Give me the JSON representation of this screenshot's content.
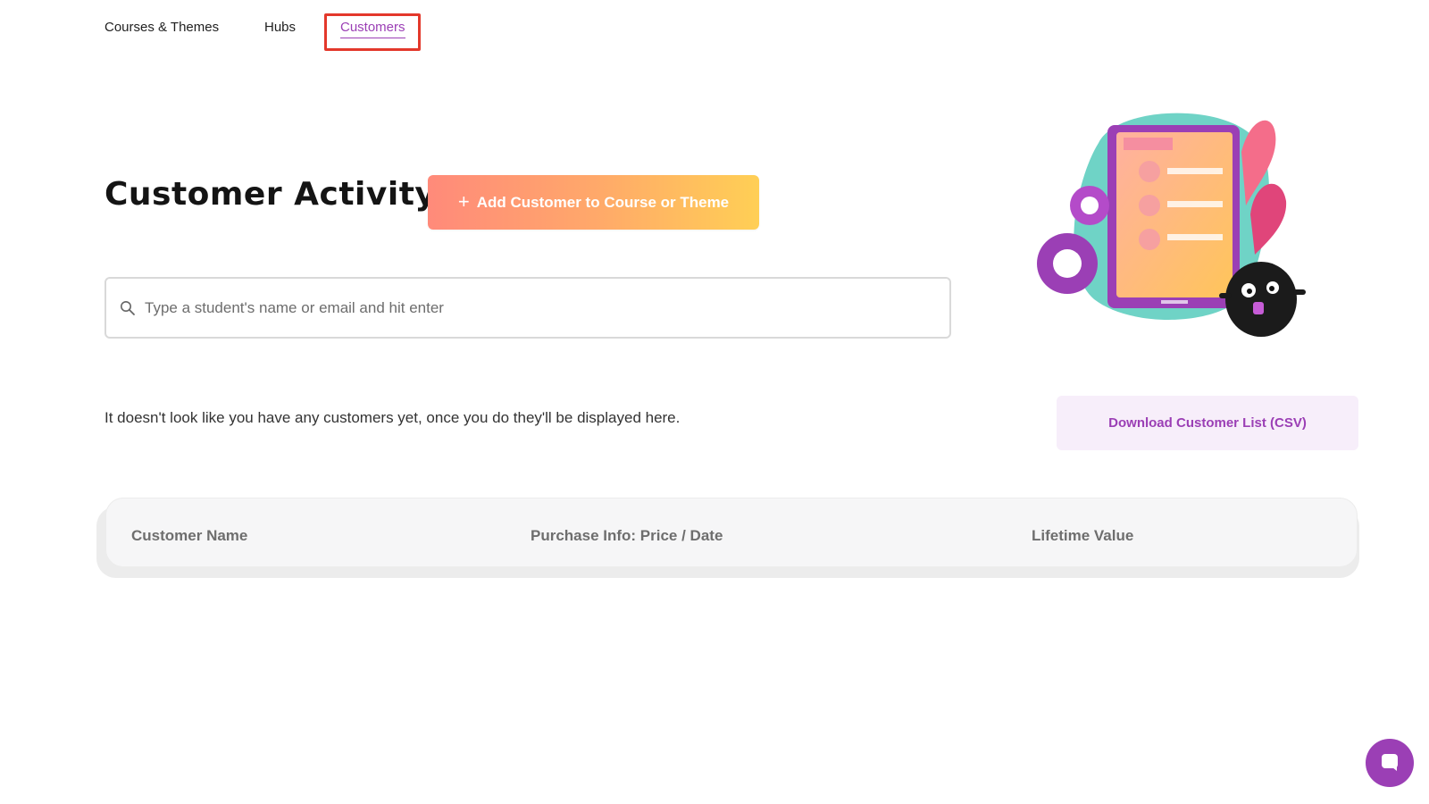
{
  "nav": {
    "items": [
      {
        "label": "Courses & Themes",
        "active": false
      },
      {
        "label": "Hubs",
        "active": false
      },
      {
        "label": "Customers",
        "active": true
      }
    ]
  },
  "main": {
    "title": "Customer Activity",
    "add_button_label": "Add Customer to Course or Theme",
    "search_placeholder": "Type a student's name or email and hit enter",
    "empty_message": "It doesn't look like you have any customers yet, once you do they'll be displayed here.",
    "download_label": "Download Customer List (CSV)"
  },
  "table": {
    "columns": [
      "Customer Name",
      "Purchase Info: Price / Date",
      "Lifetime Value"
    ]
  },
  "colors": {
    "accent": "#9b3fb5",
    "highlight_border": "#e3382b",
    "button_gradient_start": "#ff8a7a",
    "button_gradient_end": "#ffcf55"
  },
  "icons": {
    "add": "plus-icon",
    "search": "search-icon",
    "chat": "chat-bubble-icon"
  }
}
